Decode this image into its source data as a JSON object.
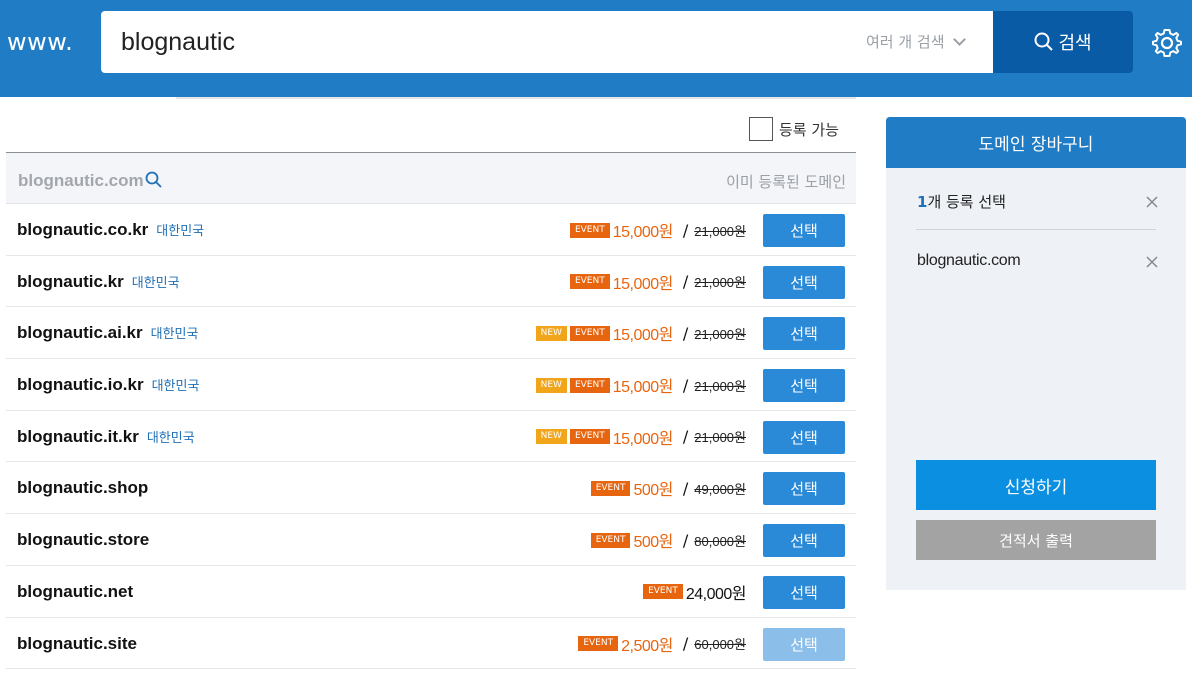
{
  "header": {
    "www_label": "www.",
    "search_value": "blognautic",
    "multi_search_label": "여러 개 검색",
    "search_button_label": "검색"
  },
  "filter": {
    "available_label": "등록 가능"
  },
  "results": {
    "head": {
      "domain": "blognautic.com",
      "status": "이미 등록된 도메인"
    },
    "rows": [
      {
        "domain": "blognautic.co.kr",
        "country": "대한민국",
        "new": "",
        "event": "EVENT",
        "price": "15,000원",
        "orig": "21,000원",
        "button": "선택"
      },
      {
        "domain": "blognautic.kr",
        "country": "대한민국",
        "new": "",
        "event": "EVENT",
        "price": "15,000원",
        "orig": "21,000원",
        "button": "선택"
      },
      {
        "domain": "blognautic.ai.kr",
        "country": "대한민국",
        "new": "NEW",
        "event": "EVENT",
        "price": "15,000원",
        "orig": "21,000원",
        "button": "선택"
      },
      {
        "domain": "blognautic.io.kr",
        "country": "대한민국",
        "new": "NEW",
        "event": "EVENT",
        "price": "15,000원",
        "orig": "21,000원",
        "button": "선택"
      },
      {
        "domain": "blognautic.it.kr",
        "country": "대한민국",
        "new": "NEW",
        "event": "EVENT",
        "price": "15,000원",
        "orig": "21,000원",
        "button": "선택"
      },
      {
        "domain": "blognautic.shop",
        "country": "",
        "new": "",
        "event": "EVENT",
        "price": "500원",
        "orig": "49,000원",
        "button": "선택"
      },
      {
        "domain": "blognautic.store",
        "country": "",
        "new": "",
        "event": "EVENT",
        "price": "500원",
        "orig": "80,000원",
        "button": "선택"
      },
      {
        "domain": "blognautic.net",
        "country": "",
        "new": "",
        "event": "EVENT",
        "price": "24,000원",
        "orig": "",
        "button": "선택"
      },
      {
        "domain": "blognautic.site",
        "country": "",
        "new": "",
        "event": "EVENT",
        "price": "2,500원",
        "orig": "60,000원",
        "button": "선택"
      }
    ]
  },
  "cart": {
    "title": "도메인 장바구니",
    "count_num": "1",
    "count_label": "개 등록 선택",
    "item": "blognautic.com",
    "apply_label": "신청하기",
    "quote_label": "견적서 출력"
  },
  "colors": {
    "brand": "#1f7cc5",
    "accent_orange": "#e8650f",
    "new_badge": "#f0a51a",
    "select_button": "#2a8ad8"
  }
}
